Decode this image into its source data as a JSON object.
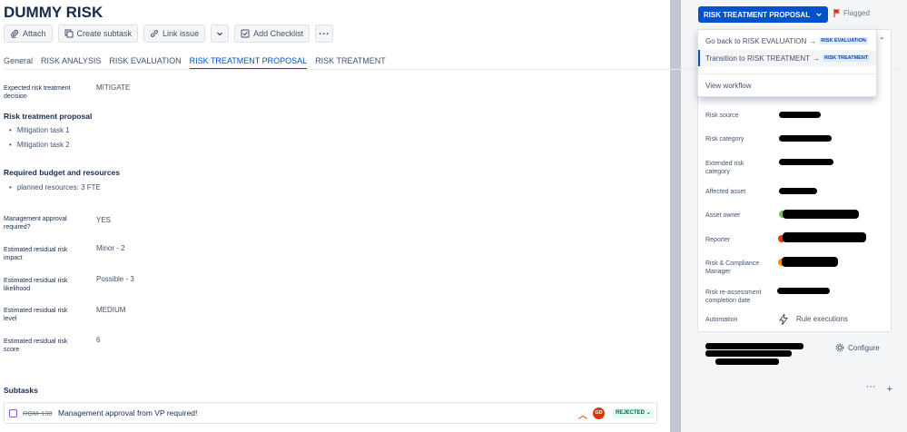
{
  "issue": {
    "title": "DUMMY RISK"
  },
  "toolbar": {
    "attach": "Attach",
    "create_subtask": "Create subtask",
    "link_issue": "Link issue",
    "add_checklist": "Add Checklist"
  },
  "tabs": [
    {
      "label": "General"
    },
    {
      "label": "RISK ANALYSIS"
    },
    {
      "label": "RISK EVALUATION"
    },
    {
      "label": "RISK TREATMENT PROPOSAL"
    },
    {
      "label": "RISK TREATMENT"
    }
  ],
  "fields": {
    "expected_decision_label": "Expected risk treatment decision",
    "expected_decision_value": "MITIGATE",
    "proposal_title": "Risk treatment proposal",
    "proposal_items": [
      "Mitigation task 1",
      "Mitigation task 2"
    ],
    "budget_title": "Required budget and resources",
    "budget_items": [
      "planned resources: 3 FTE"
    ],
    "mgmt_approval_label": "Management approval required?",
    "mgmt_approval_value": "YES",
    "impact_label": "Estimated residual risk impact",
    "impact_value": "Minor - 2",
    "likelihood_label": "Estimated residual risk likelihood",
    "likelihood_value": "Possible - 3",
    "level_label": "Estimated residual risk level",
    "level_value": "MEDIUM",
    "score_label": "Estimated residual risk score",
    "score_value": "6"
  },
  "subtasks": {
    "title": "Subtasks",
    "items": [
      {
        "key": "ROM-138",
        "summary": "Management approval from VP required!",
        "assignee_initials": "GD",
        "status": "REJECTED"
      }
    ]
  },
  "status_button": {
    "label": "RISK TREATMENT PROPOSAL"
  },
  "flag": {
    "label": "Flagged"
  },
  "transition_menu": {
    "items": [
      {
        "label": "Go back to RISK EVALUATION",
        "target": "RISK EVALUATION"
      },
      {
        "label": "Transition to RISK TREATMENT",
        "target": "RISK TREATMENT"
      }
    ],
    "view_workflow": "View workflow"
  },
  "details": {
    "risk_source": "Risk source",
    "risk_category": "Risk category",
    "extended_category": "Extended risk category",
    "affected_asset": "Affected asset",
    "asset_owner": "Asset owner",
    "reporter": "Reporter",
    "compliance_manager": "Risk & Compliance Manager",
    "reassessment_date": "Risk re-assessment completion date",
    "automation": "Automation",
    "rule_executions": "Rule executions"
  },
  "footer": {
    "configure": "Configure"
  },
  "colors": {
    "primary": "#0052cc",
    "flag": "#de350b",
    "status_green": "#006644",
    "subtask_purple": "#904ee2"
  }
}
